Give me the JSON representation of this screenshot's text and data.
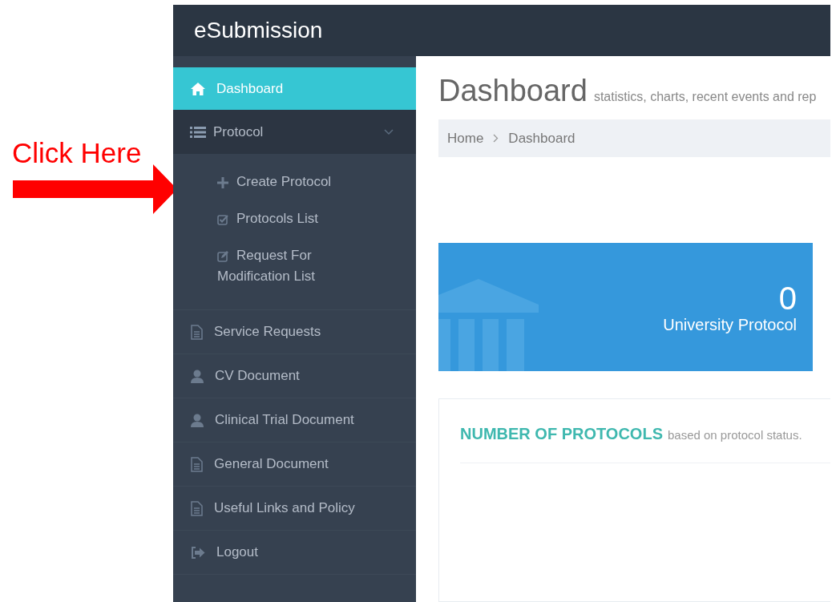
{
  "annotation": {
    "text": "Click Here"
  },
  "header": {
    "brand": "eSubmission"
  },
  "sidebar": {
    "items": [
      {
        "kind": "item",
        "label": "Dashboard",
        "selected": true
      },
      {
        "kind": "group",
        "label": "Protocol",
        "selected": false,
        "expanded": true,
        "children": [
          {
            "label": "Create Protocol",
            "selected": false
          },
          {
            "label": "Protocols List",
            "selected": false
          },
          {
            "label": "Request For Modification List",
            "selected": false
          }
        ]
      },
      {
        "kind": "item",
        "label": "Service Requests",
        "selected": false
      },
      {
        "kind": "item",
        "label": "CV Document",
        "selected": false
      },
      {
        "kind": "item",
        "label": "Clinical Trial Document",
        "selected": false
      },
      {
        "kind": "item",
        "label": "General Document",
        "selected": false
      },
      {
        "kind": "item",
        "label": "Useful Links and Policy",
        "selected": false
      },
      {
        "kind": "item",
        "label": "Logout",
        "selected": false
      }
    ]
  },
  "page": {
    "title": "Dashboard",
    "subtitle": "statistics, charts, recent events and rep",
    "breadcrumb": [
      "Home",
      "Dashboard"
    ],
    "stat_tile": {
      "value": "0",
      "label": "University Protocol"
    },
    "portlet": {
      "title": "NUMBER OF PROTOCOLS",
      "subtitle": "based on protocol status."
    }
  }
}
